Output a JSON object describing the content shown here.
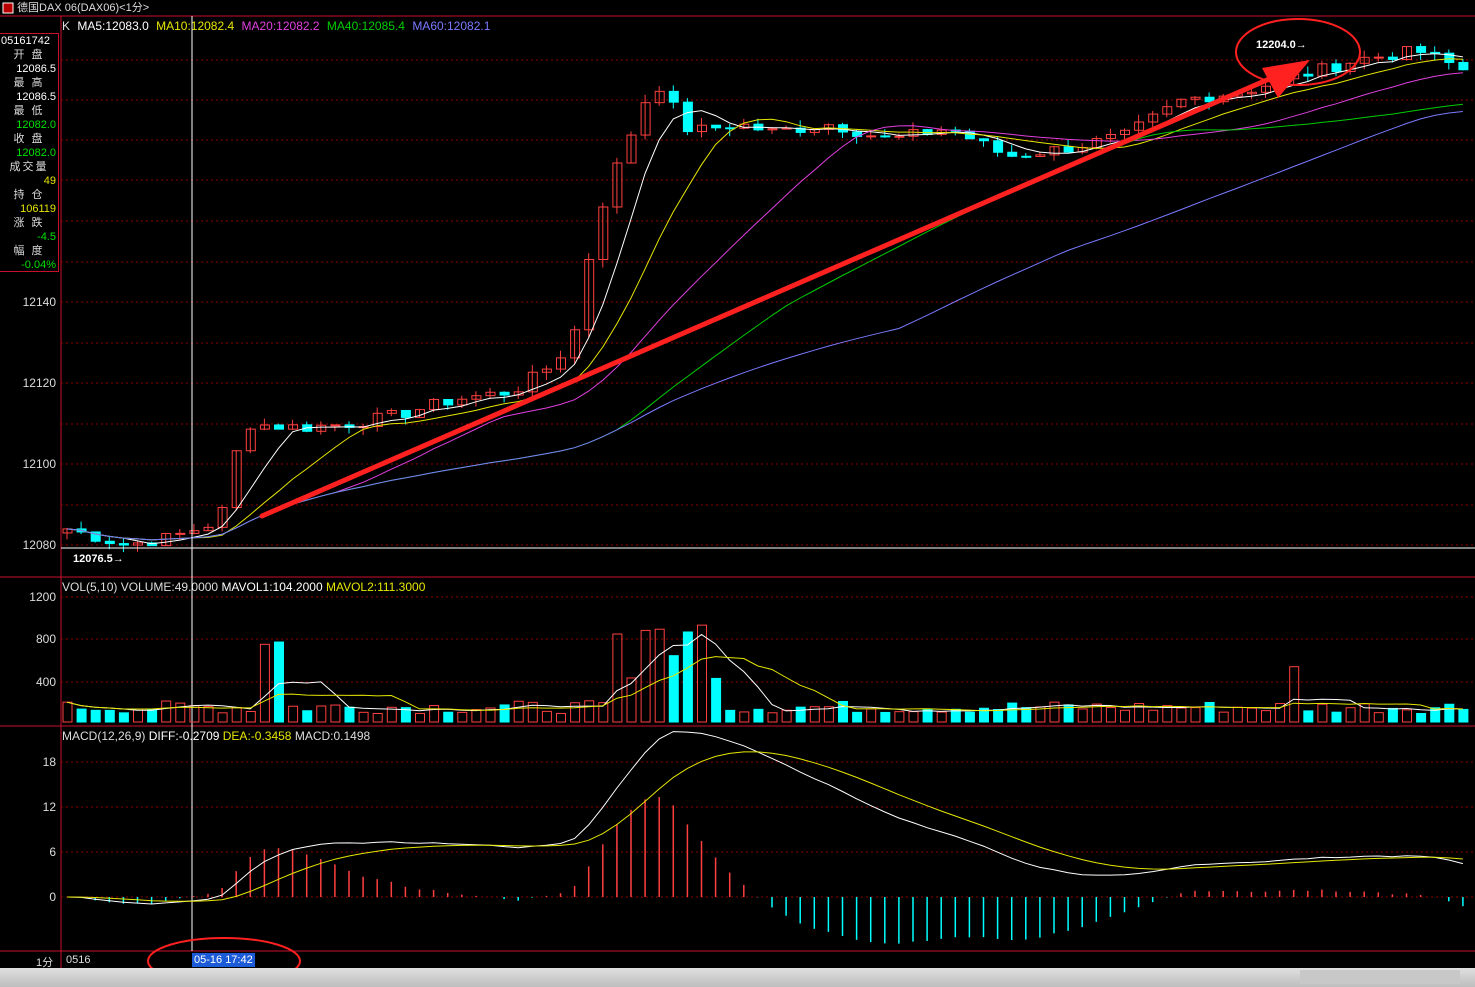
{
  "window": {
    "title": "德国DAX 06(DAX06)<1分>"
  },
  "price_legend": {
    "label": "K",
    "items": [
      {
        "text": "MA5:12083.0",
        "color": "#ffffff"
      },
      {
        "text": "MA10:12082.4",
        "color": "#e6e600"
      },
      {
        "text": "MA20:12082.2",
        "color": "#e040e0"
      },
      {
        "text": "MA40:12085.4",
        "color": "#00cc00"
      },
      {
        "text": "MA60:12082.1",
        "color": "#7a7aff"
      }
    ]
  },
  "info_panel": {
    "code": "05161742",
    "rows": [
      {
        "label": "开  盘",
        "value": "12086.5",
        "color": "#ffffff"
      },
      {
        "label": "最  高",
        "value": "12086.5",
        "color": "#ffffff"
      },
      {
        "label": "最  低",
        "value": "12082.0",
        "color": "#00e000"
      },
      {
        "label": "收  盘",
        "value": "12082.0",
        "color": "#00e000"
      },
      {
        "label": "成交量",
        "value": "49",
        "color": "#e6e600"
      },
      {
        "label": "持  仓",
        "value": "106119",
        "color": "#e6e600"
      },
      {
        "label": "涨  跌",
        "value": "-4.5",
        "color": "#00e000"
      },
      {
        "label": "幅  度",
        "value": "-0.04%",
        "color": "#00e000"
      }
    ]
  },
  "price_axis": [
    "12140",
    "12120",
    "12100",
    "12080"
  ],
  "price_annotations": {
    "high": "12204.0→",
    "low": "12076.5→"
  },
  "volume_legend": {
    "items": [
      {
        "text": "VOL(5,10)",
        "color": "#dddddd"
      },
      {
        "text": "VOLUME:49.0000",
        "color": "#dddddd"
      },
      {
        "text": "MAVOL1:104.2000",
        "color": "#ffffff"
      },
      {
        "text": "MAVOL2:111.3000",
        "color": "#e6e600"
      }
    ]
  },
  "volume_axis": [
    "1200",
    "800",
    "400"
  ],
  "macd_legend": {
    "items": [
      {
        "text": "MACD(12,26,9)",
        "color": "#dddddd"
      },
      {
        "text": "DIFF:-0.2709",
        "color": "#ffffff"
      },
      {
        "text": "DEA:-0.3458",
        "color": "#e6e600"
      },
      {
        "text": "MACD:0.1498",
        "color": "#dddddd"
      }
    ]
  },
  "macd_axis": [
    "18",
    "12",
    "6",
    "0"
  ],
  "time_axis": {
    "period": "1分",
    "start": "0516",
    "cursor": "05-16 17:42"
  },
  "colors": {
    "up": "#ff4040",
    "down": "#00ffff",
    "grid": "#8b0000",
    "border": "#c8102e",
    "annotation": "#ff2020"
  }
}
